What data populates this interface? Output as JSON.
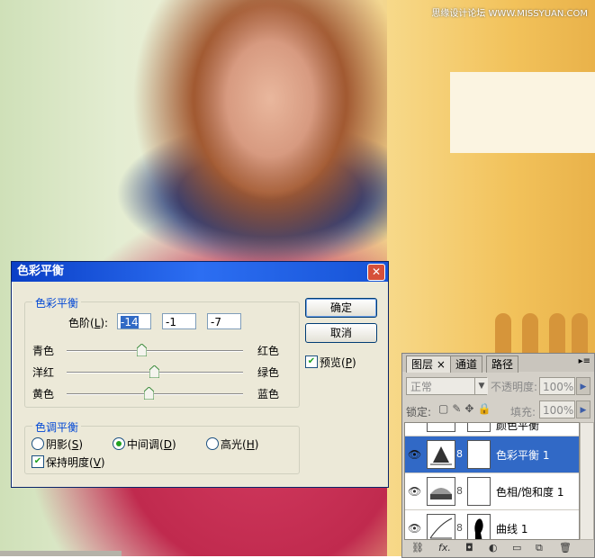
{
  "watermark": "思缘设计论坛  WWW.MISSYUAN.COM",
  "dialog": {
    "title": "色彩平衡",
    "close_icon": "close-icon",
    "color_balance_group": "色彩平衡",
    "levels_label_prefix": "色阶(",
    "levels_label_key": "L",
    "levels_label_suffix": "):",
    "levels": [
      "-14",
      "-1",
      "-7"
    ],
    "sliders": [
      {
        "left": "青色",
        "right": "红色",
        "value": -14
      },
      {
        "left": "洋红",
        "right": "绿色",
        "value": -1
      },
      {
        "left": "黄色",
        "right": "蓝色",
        "value": -7
      }
    ],
    "tone_group": "色调平衡",
    "tones": [
      {
        "label": "阴影",
        "key": "S",
        "selected": false
      },
      {
        "label": "中间调",
        "key": "D",
        "selected": true
      },
      {
        "label": "高光",
        "key": "H",
        "selected": false
      }
    ],
    "preserve_label": "保持明度",
    "preserve_key": "V",
    "preserve_checked": true,
    "ok_label": "确定",
    "cancel_label": "取消",
    "preview_label": "预览",
    "preview_key": "P",
    "preview_checked": true
  },
  "layers_panel": {
    "tabs": [
      "图层",
      "通道",
      "路径"
    ],
    "tab_close": "×",
    "blend_mode": "正常",
    "opacity_label": "不透明度:",
    "opacity": "100%",
    "lock_label": "锁定:",
    "fill_label": "填充:",
    "fill": "100%",
    "layers": [
      {
        "name": "颜色平衡",
        "active": false,
        "partial": true
      },
      {
        "name": "色彩平衡 1",
        "active": true
      },
      {
        "name": "色相/饱和度 1",
        "active": false
      },
      {
        "name": "曲线 1",
        "active": false
      }
    ],
    "bottom_icons": [
      "link-icon",
      "fx-icon",
      "mask-icon",
      "adjustment-icon",
      "folder-icon",
      "new-layer-icon",
      "trash-icon"
    ],
    "bottom_fx": "fx."
  },
  "colors": {
    "title_bar": "#2c6ef2",
    "group_label": "#0046d5",
    "active_layer": "#3169c6"
  }
}
